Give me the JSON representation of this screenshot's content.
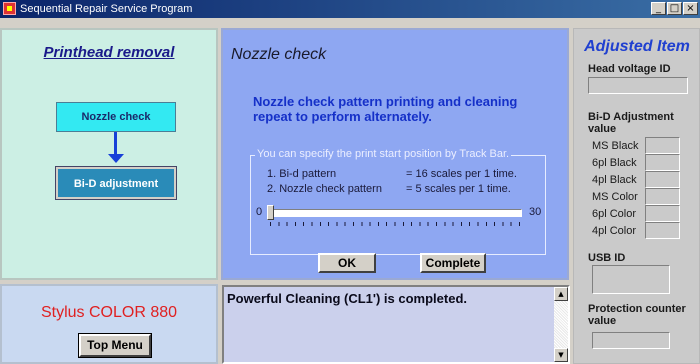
{
  "window": {
    "title": "Sequential Repair Service Program",
    "min": "_",
    "max": "□",
    "close": "×"
  },
  "left_panel": {
    "title": "Printhead removal",
    "flow": [
      "Nozzle check",
      "Bi-D adjustment"
    ]
  },
  "model_panel": {
    "model": "Stylus COLOR 880",
    "top_menu_label": "Top Menu"
  },
  "center_panel": {
    "title": "Nozzle check",
    "description": "Nozzle check pattern printing and cleaning repeat to perform alternately.",
    "group_label": "You can specify the print start position by Track Bar.",
    "lines": [
      {
        "label": "1. Bi-d pattern",
        "value": "= 16 scales per 1 time."
      },
      {
        "label": "2. Nozzle check pattern",
        "value": "=  5 scales per 1 time."
      }
    ],
    "track": {
      "min": "0",
      "max": "30",
      "value": 0
    },
    "ok_label": "OK",
    "complete_label": "Complete"
  },
  "message": {
    "text": "Powerful Cleaning (CL1') is completed."
  },
  "right_panel": {
    "title": "Adjusted Item",
    "head_voltage_label": "Head voltage ID",
    "bid_label": "Bi-D Adjustment value",
    "bid_rows": [
      "MS Black",
      "6pl Black",
      "4pl Black",
      "MS Color",
      "6pl Color",
      "4pl Color"
    ],
    "usb_label": "USB ID",
    "protection_label": "Protection counter value"
  },
  "colors": {
    "center_bg": "#8ea7f2",
    "accent": "#1530c8",
    "model_red": "#e02020"
  }
}
